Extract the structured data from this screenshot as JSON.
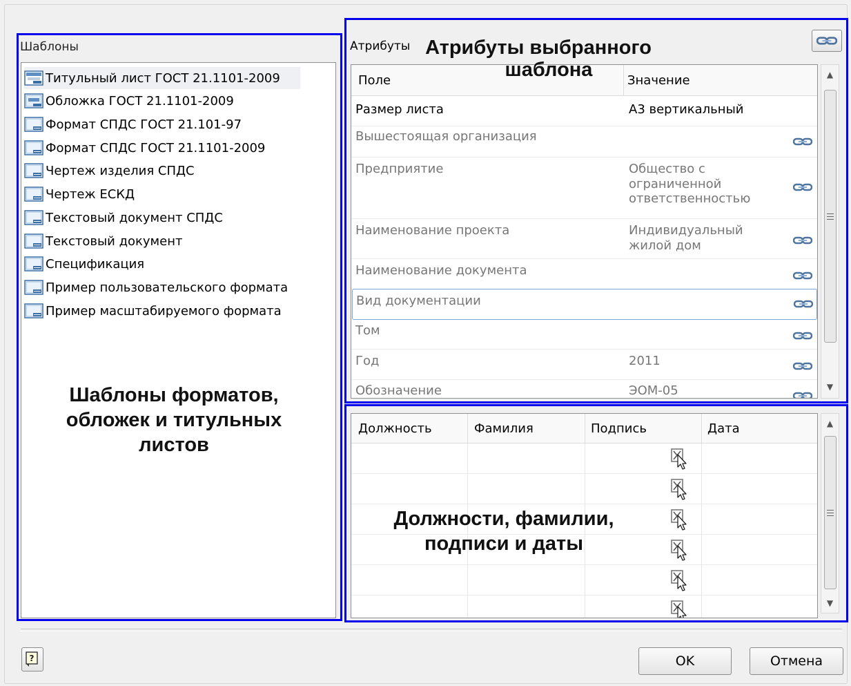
{
  "templates_panel": {
    "label": "Шаблоны",
    "items": [
      {
        "label": "Титульный лист ГОСТ 21.1101-2009",
        "icon": "title-sheet-icon",
        "selected": true
      },
      {
        "label": "Обложка ГОСТ 21.1101-2009",
        "icon": "cover-icon"
      },
      {
        "label": "Формат СПДС ГОСТ 21.101-97",
        "icon": "format-icon"
      },
      {
        "label": "Формат СПДС ГОСТ 21.1101-2009",
        "icon": "format-icon"
      },
      {
        "label": "Чертеж изделия СПДС",
        "icon": "format-icon"
      },
      {
        "label": "Чертеж ЕСКД",
        "icon": "format-icon"
      },
      {
        "label": "Текстовый документ СПДС",
        "icon": "format-icon"
      },
      {
        "label": "Текстовый документ",
        "icon": "format-icon"
      },
      {
        "label": "Спецификация",
        "icon": "format-icon"
      },
      {
        "label": "Пример пользовательского формата",
        "icon": "format-icon"
      },
      {
        "label": "Пример масштабируемого формата",
        "icon": "format-icon"
      }
    ],
    "annotation": [
      "Шаблоны форматов,",
      "обложек и титульных",
      "листов"
    ]
  },
  "attributes_panel": {
    "label": "Атрибуты",
    "annotation": [
      "Атрибуты выбранного",
      "шаблона"
    ],
    "columns": [
      "Поле",
      "Значение"
    ],
    "rows": [
      {
        "field": "Размер листа",
        "value": "А3 вертикальный",
        "linked": false,
        "strong": true
      },
      {
        "field": "Вышестоящая организация",
        "value": "",
        "linked": true
      },
      {
        "field": "Предприятие",
        "value": "Общество с ограниченной ответственностью",
        "linked": true
      },
      {
        "field": "Наименование проекта",
        "value": "Индивидуальный жилой дом",
        "linked": true
      },
      {
        "field": "Наименование документа",
        "value": "",
        "linked": true
      },
      {
        "field": "Вид документации",
        "value": "",
        "linked": true,
        "focused": true
      },
      {
        "field": "Том",
        "value": "",
        "linked": true
      },
      {
        "field": "Год",
        "value": "2011",
        "linked": true
      },
      {
        "field": "Обозначение",
        "value": "ЭОМ-05",
        "linked": true
      }
    ]
  },
  "signatures_panel": {
    "columns": [
      "Должность",
      "Фамилия",
      "Подпись",
      "Дата"
    ],
    "row_count": 6,
    "annotation": [
      "Должности, фамилии,",
      "подписи и даты"
    ]
  },
  "footer": {
    "ok_label": "OK",
    "cancel_label": "Отмена",
    "help_icon": "help-icon"
  },
  "colors": {
    "callout_border": "#0000ee",
    "link_icon": "#5a7fa8"
  }
}
